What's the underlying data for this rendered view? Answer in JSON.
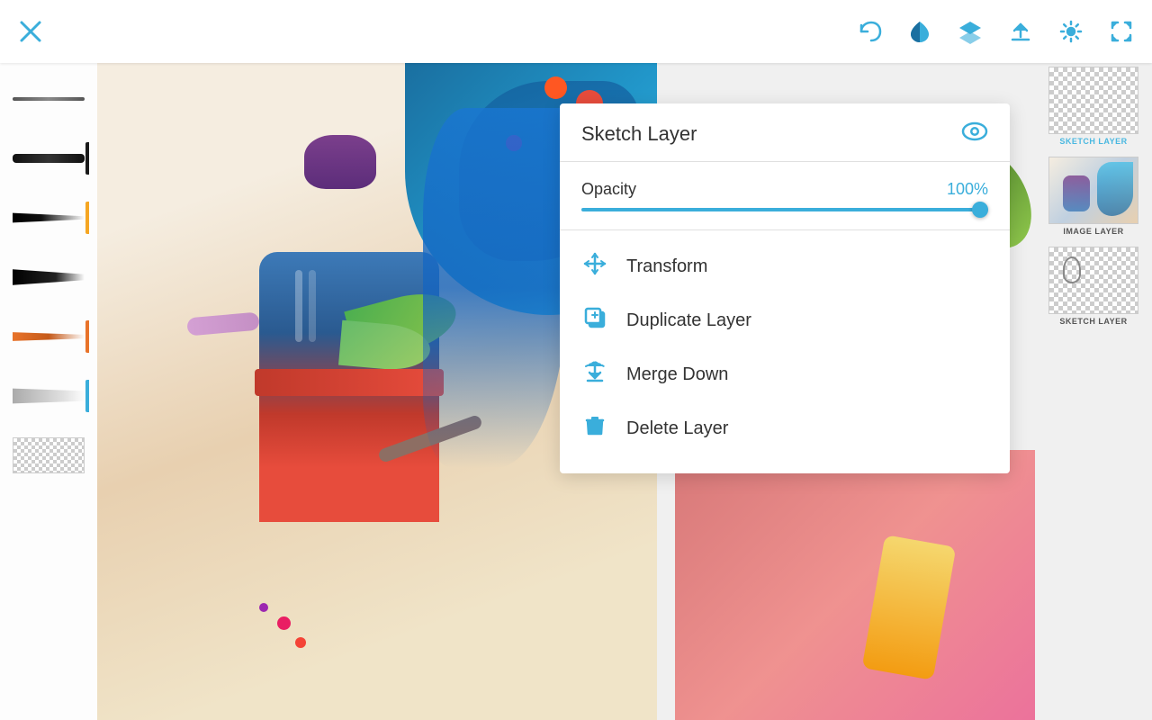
{
  "toolbar": {
    "close_label": "×",
    "undo_label": "↩",
    "color_label": "◑",
    "layers_label": "◆",
    "upload_label": "↑",
    "settings_label": "⚙",
    "fullscreen_label": "⛶"
  },
  "brushes": [
    {
      "id": "brush-1",
      "type": "thin-dark",
      "active": false,
      "color": "#222",
      "indicator_color": null
    },
    {
      "id": "brush-2",
      "type": "medium-dark",
      "active": true,
      "color": "#111",
      "indicator_color": "#1a1a1a"
    },
    {
      "id": "brush-3",
      "type": "tapered-dark",
      "active": false,
      "color": "#111",
      "indicator_color": "#f5a623"
    },
    {
      "id": "brush-4",
      "type": "tapered-black",
      "active": false,
      "color": "#000",
      "indicator_color": null
    },
    {
      "id": "brush-5",
      "type": "orange-accent",
      "active": false,
      "color": "#e8732a",
      "indicator_color": "#e8732a"
    },
    {
      "id": "brush-6",
      "type": "gray-soft",
      "active": false,
      "color": "#888",
      "indicator_color": "#3aaedb"
    },
    {
      "id": "brush-7",
      "type": "checker",
      "active": false,
      "color": "checker",
      "indicator_color": null
    }
  ],
  "layers": [
    {
      "id": "layer-sketch-top",
      "label": "SKETCH LAYER",
      "label_color": "blue",
      "type": "sketch"
    },
    {
      "id": "layer-image",
      "label": "IMAGE LAYER",
      "label_color": "dark",
      "type": "image"
    },
    {
      "id": "layer-sketch-bottom",
      "label": "SKETCH LAYER",
      "label_color": "dark",
      "type": "sketch"
    }
  ],
  "add_layer_button": "+",
  "context_menu": {
    "title": "Sketch Layer",
    "opacity_label": "Opacity",
    "opacity_value": "100%",
    "slider_percent": 100,
    "eye_visible": true,
    "menu_items": [
      {
        "id": "transform",
        "label": "Transform",
        "icon": "move"
      },
      {
        "id": "duplicate",
        "label": "Duplicate Layer",
        "icon": "duplicate"
      },
      {
        "id": "merge",
        "label": "Merge Down",
        "icon": "merge"
      },
      {
        "id": "delete",
        "label": "Delete Layer",
        "icon": "trash"
      }
    ]
  }
}
